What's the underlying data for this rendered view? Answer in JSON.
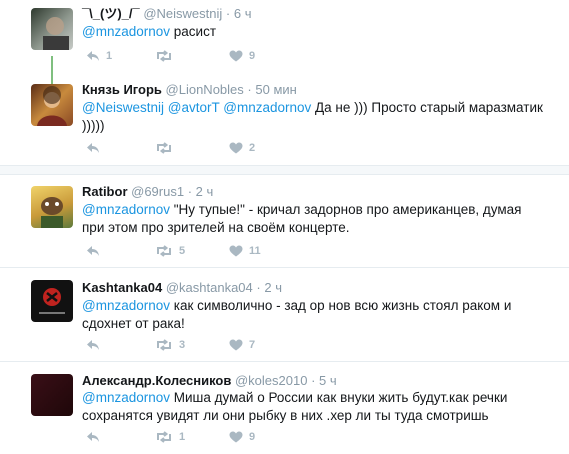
{
  "tweets": [
    {
      "name": "¯\\_(ツ)_/¯",
      "handle": "@Neiswestnij",
      "time": "6 ч",
      "mentions": [
        "@mnzadornov"
      ],
      "text": "расист",
      "replies": "1",
      "retweets": "",
      "likes": "9",
      "avatar_colors": [
        "#3b4a3a",
        "#9aa39a"
      ]
    },
    {
      "name": "Князь Игорь",
      "handle": "@LionNobles",
      "time": "50 мин",
      "mentions": [
        "@Neiswestnij",
        "@avtorT",
        "@mnzadornov"
      ],
      "text": "Да не ))) Просто старый маразматик )))))",
      "replies": "",
      "retweets": "",
      "likes": "2",
      "avatar_colors": [
        "#6b3a1f",
        "#d19a4a"
      ]
    },
    {
      "name": "Ratibor",
      "handle": "@69rus1",
      "time": "2 ч",
      "mentions": [
        "@mnzadornov"
      ],
      "text": "\"Ну тупые!\" - кричал задорнов про американцев, думая при этом про зрителей на своём концерте.",
      "replies": "",
      "retweets": "5",
      "likes": "11",
      "avatar_colors": [
        "#c9a24a",
        "#5c7a3a"
      ]
    },
    {
      "name": "Kashtanka04",
      "handle": "@kashtanka04",
      "time": "2 ч",
      "mentions": [
        "@mnzadornov"
      ],
      "text": "как символично - зад ор нов всю жизнь стоял раком и сдохнет от рака!",
      "replies": "",
      "retweets": "3",
      "likes": "7",
      "avatar_colors": [
        "#111111",
        "#c0231f"
      ]
    },
    {
      "name": "Александр.Колесников",
      "handle": "@koles2010",
      "time": "5 ч",
      "mentions": [
        "@mnzadornov"
      ],
      "text": "Миша думай о России как внуки жить будут.как речки сохранятся увидят ли они рыбку в них .хер ли ты туда смотришь",
      "replies": "",
      "retweets": "1",
      "likes": "9",
      "avatar_colors": [
        "#2a0d12",
        "#3d1018"
      ]
    }
  ],
  "separator": "·",
  "colors": {
    "mention": "#1b95e0",
    "muted": "#8899a6",
    "action": "#aab8c2",
    "thread_line": "#7fbf7f"
  }
}
